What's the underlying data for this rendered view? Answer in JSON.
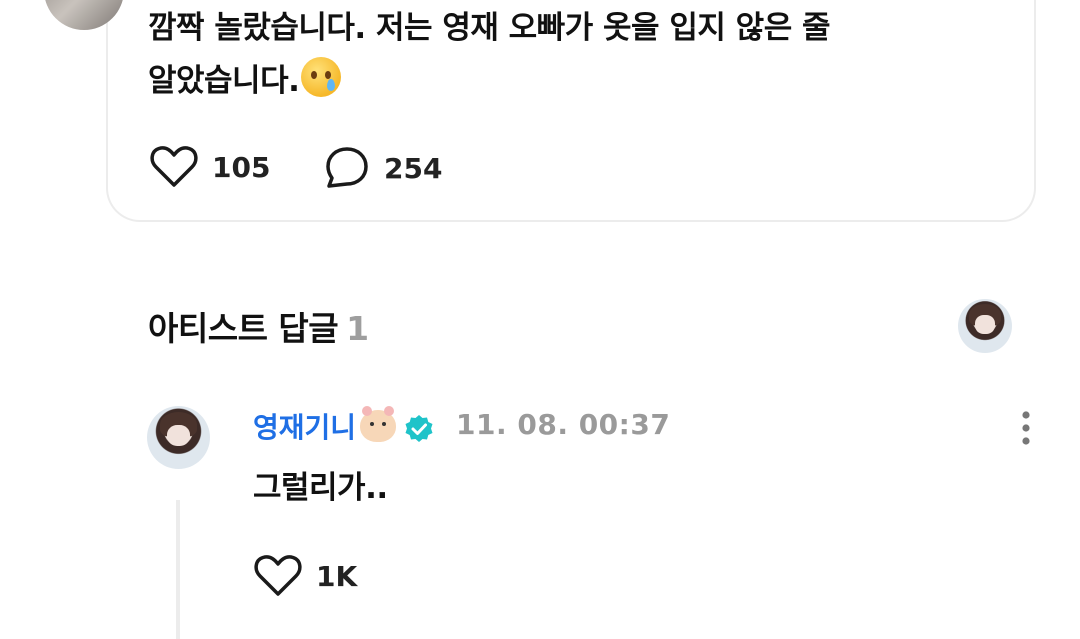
{
  "post": {
    "text_line1": "깜짝 놀랐습니다. 저는 영재 오빠가 옷을 입지 않은 줄",
    "text_line2": "알았습니다.",
    "emoji_icon": "crying-face",
    "likes": "105",
    "comments": "254"
  },
  "artist_replies": {
    "title": "아티스트 답글",
    "count": "1"
  },
  "reply": {
    "author": "영재기니",
    "author_emoji": "hamster-face",
    "verified": true,
    "timestamp": "11. 08. 00:37",
    "text": "그럴리가..",
    "likes": "1K"
  },
  "colors": {
    "accent_name": "#1f6fe5",
    "verified_badge": "#1fc3c9",
    "muted": "#9a9a9a",
    "border": "#ececec"
  }
}
